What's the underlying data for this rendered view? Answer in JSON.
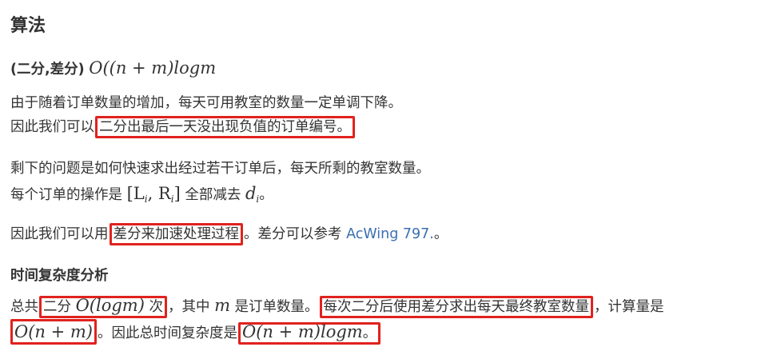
{
  "heading": "算法",
  "method": {
    "tag": "(二分,差分)",
    "complexity": "O((n + m)logm"
  },
  "para1": {
    "line1": "由于随着订单数量的增加，每天可用教室的数量一定单调下降。",
    "line2_pre": "因此我们可以",
    "line2_hl": "二分出最后一天没出现负值的订单编号。"
  },
  "para2": {
    "line1": "剩下的问题是如何快速求出经过若干订单后，每天所剩的教室数量。",
    "line2_pre": "每个订单的操作是",
    "interval": "[L",
    "interval_sub_l": "i",
    "interval_mid": ", R",
    "interval_sub_r": "i",
    "interval_end": "]",
    "line2_mid": "全部减去",
    "d_var": "d",
    "d_sub": "i",
    "line2_end": "。"
  },
  "para3": {
    "pre": "因此我们可以用",
    "hl": "差分来加速处理过程",
    "mid": "。差分可以参考 ",
    "link": "AcWing 797.",
    "end": "。"
  },
  "section2": {
    "heading": "时间复杂度分析",
    "l1_pre": "总共",
    "l1_hl_text": "二分 ",
    "l1_hl_math": "O(logm)",
    "l1_hl_end": " 次",
    "l1_mid": "，其中 ",
    "l1_m": "m",
    "l1_mid2": " 是订单数量。",
    "l1_hl2": "每次二分后使用差分求出每天最终教室数量",
    "l1_end": "，计算量是",
    "l2_hl_math": "O(n + m)",
    "l2_mid": "。因此总时间复杂度是",
    "l2_hl2_math": "O(n + m)logm",
    "l2_end": "。"
  }
}
